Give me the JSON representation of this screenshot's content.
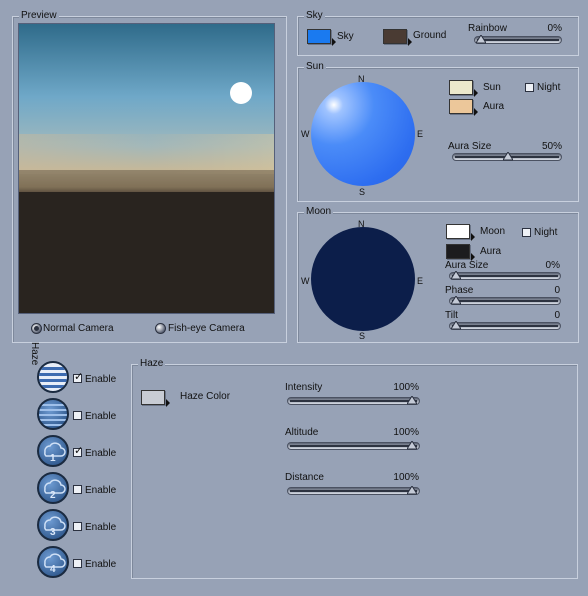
{
  "preview": {
    "title": "Preview",
    "camera_modes": [
      {
        "label": "Normal Camera",
        "selected": true
      },
      {
        "label": "Fish-eye Camera",
        "selected": false
      }
    ]
  },
  "sky": {
    "title": "Sky",
    "sky_label": "Sky",
    "sky_color": "#1a7af0",
    "ground_label": "Ground",
    "ground_color": "#4a3b33",
    "rainbow_label": "Rainbow",
    "rainbow_value": "0%",
    "rainbow_level": 0
  },
  "sun": {
    "title": "Sun",
    "sun_label": "Sun",
    "sun_color": "#ece9cc",
    "aura_label": "Aura",
    "aura_color": "#ecc79a",
    "night_label": "Night",
    "night_checked": false,
    "aura_size_label": "Aura Size",
    "aura_size_value": "50%",
    "aura_size_level": 0.5,
    "compass": {
      "n": "N",
      "s": "S",
      "e": "E",
      "w": "W"
    }
  },
  "moon": {
    "title": "Moon",
    "moon_label": "Moon",
    "moon_color": "#ffffff",
    "aura_label": "Aura",
    "aura_color": "#1c1c1e",
    "night_label": "Night",
    "night_checked": false,
    "aura_size_label": "Aura Size",
    "aura_size_value": "0%",
    "phase_label": "Phase",
    "phase_value": "0",
    "tilt_label": "Tilt",
    "tilt_value": "0",
    "compass": {
      "n": "N",
      "s": "S",
      "e": "E",
      "w": "W"
    }
  },
  "haze_sidebar": {
    "label": "Haze",
    "layers": [
      {
        "icon": "haze-lines-icon",
        "enable_label": "Enable",
        "checked": true
      },
      {
        "icon": "haze-dots-icon",
        "enable_label": "Enable",
        "checked": false
      },
      {
        "icon": "cloud-1-icon",
        "number": "1",
        "enable_label": "Enable",
        "checked": true
      },
      {
        "icon": "cloud-2-icon",
        "number": "2",
        "enable_label": "Enable",
        "checked": false
      },
      {
        "icon": "cloud-3-icon",
        "number": "3",
        "enable_label": "Enable",
        "checked": false
      },
      {
        "icon": "cloud-4-icon",
        "number": "4",
        "enable_label": "Enable",
        "checked": false
      }
    ]
  },
  "haze": {
    "title": "Haze",
    "color_label": "Haze Color",
    "color": "#c8ccd4",
    "intensity_label": "Intensity",
    "intensity_value": "100%",
    "altitude_label": "Altitude",
    "altitude_value": "100%",
    "distance_label": "Distance",
    "distance_value": "100%"
  }
}
